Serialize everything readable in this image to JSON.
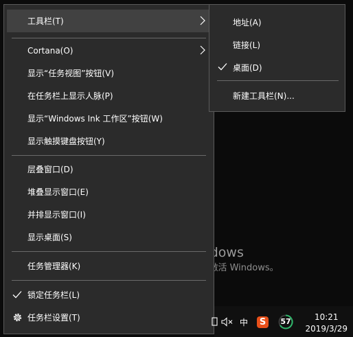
{
  "watermark": {
    "title": "激活 Windows",
    "subtitle": "转到“设置”以激活 Windows。"
  },
  "menu": {
    "items": [
      {
        "label": "工具栏(T)"
      },
      {
        "label": "Cortana(O)"
      },
      {
        "label": "显示“任务视图”按钮(V)"
      },
      {
        "label": "在任务栏上显示人脉(P)"
      },
      {
        "label": "显示“Windows Ink 工作区”按钮(W)"
      },
      {
        "label": "显示触摸键盘按钮(Y)"
      },
      {
        "label": "层叠窗口(D)"
      },
      {
        "label": "堆叠显示窗口(E)"
      },
      {
        "label": "并排显示窗口(I)"
      },
      {
        "label": "显示桌面(S)"
      },
      {
        "label": "任务管理器(K)"
      },
      {
        "label": "锁定任务栏(L)"
      },
      {
        "label": "任务栏设置(T)"
      }
    ]
  },
  "submenu": {
    "items": [
      {
        "label": "地址(A)"
      },
      {
        "label": "链接(L)"
      },
      {
        "label": "桌面(D)"
      },
      {
        "label": "新建工具栏(N)..."
      }
    ]
  },
  "taskbar": {
    "ime_label": "中",
    "sogou_label": "S",
    "badge_value": "57",
    "time": "10:21",
    "date": "2019/3/29"
  },
  "colors": {
    "menu_bg": "#2b2b2b",
    "hover_bg": "#414141",
    "sogou": "#e8501a",
    "ring": "#2fb86b"
  }
}
